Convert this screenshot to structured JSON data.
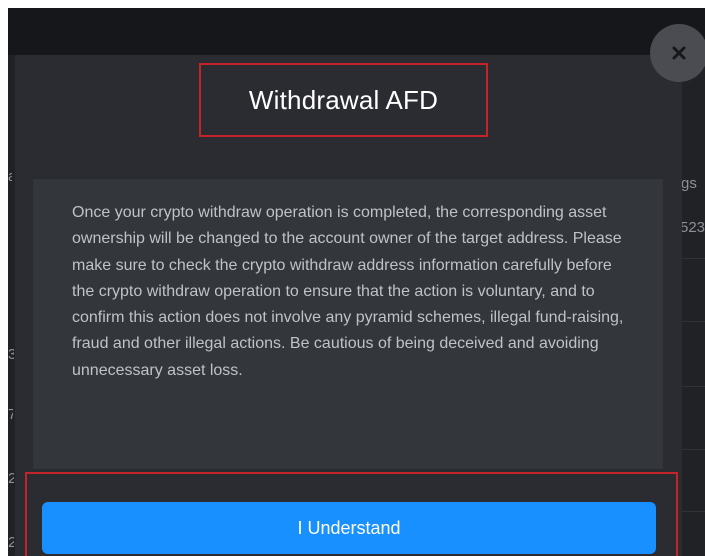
{
  "dialog": {
    "title": "Withdrawal AFD",
    "notice": "Once your crypto withdraw operation is completed, the corresponding asset ownership will be changed to the account owner of the target address. Please make sure to check the crypto withdraw address information carefully before the crypto withdraw operation to ensure that the action is voluntary, and to confirm this action does not involve any pyramid schemes, illegal fund-raising, fraud and other illegal actions. Be cautious of being deceived and avoiding unnecessary asset loss.",
    "confirm_label": "I Understand",
    "close_icon": "close-icon"
  },
  "background": {
    "peek_right_header": "gs",
    "peek_right_value": "523",
    "peek_left": [
      "a",
      "3",
      "7",
      "2",
      "2"
    ]
  },
  "colors": {
    "primary_button": "#1890ff",
    "highlight_border": "#c4232a",
    "modal_bg": "#2a2c31",
    "notice_bg": "#33363b"
  }
}
